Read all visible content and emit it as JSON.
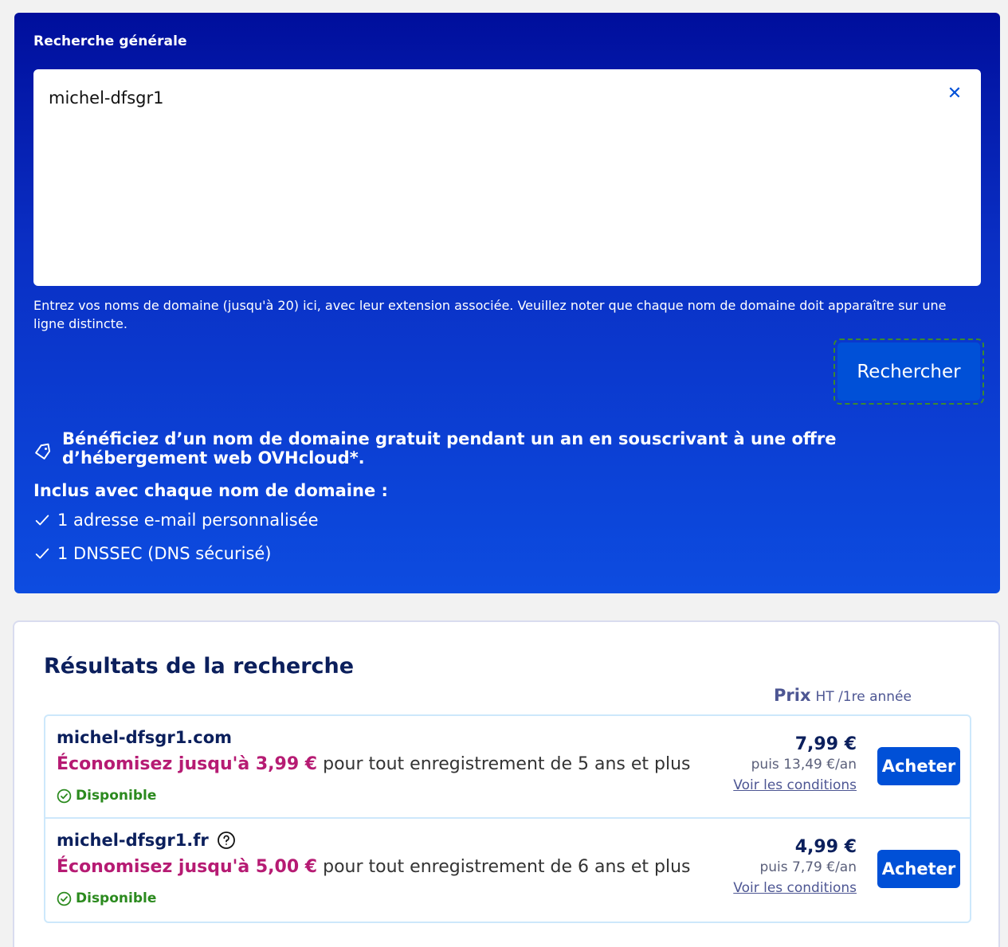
{
  "search": {
    "label": "Recherche générale",
    "value": "michel-dfsgr1",
    "clear_icon": "close-icon",
    "helper": "Entrez vos noms de domaine (jusqu'à 20) ici, avec leur extension associée. Veuillez noter que chaque nom de domaine doit apparaître sur une ligne distincte.",
    "button_label": "Rechercher"
  },
  "promo": {
    "icon": "tag-icon",
    "text": "Bénéficiez d’un nom de domaine gratuit pendant un an en souscrivant à une offre d’hébergement web OVHcloud*."
  },
  "included": {
    "title": "Inclus avec chaque nom de domaine :",
    "items": [
      {
        "icon": "check-icon",
        "label": "1 adresse e-mail personnalisée"
      },
      {
        "icon": "check-icon",
        "label": "1 DNSSEC (DNS sécurisé)"
      }
    ]
  },
  "results": {
    "title": "Résultats de la recherche",
    "price_header": {
      "label": "Prix",
      "sub": "HT /1re année"
    },
    "rows": [
      {
        "domain": "michel-dfsgr1.com",
        "saving": "Économisez jusqu'à 3,99 €",
        "saving_rest": " pour tout enregistrement de 5 ans et plus",
        "status": "Disponible",
        "price": "7,99 €",
        "then": "puis 13,49 €/an",
        "conditions": "Voir les conditions",
        "buy": "Acheter"
      },
      {
        "domain": "michel-dfsgr1.fr",
        "help_icon": "question-circle-icon",
        "saving": "Économisez jusqu'à 5,00 €",
        "saving_rest": " pour tout enregistrement de 6 ans et plus",
        "status": "Disponible",
        "price": "4,99 €",
        "then": "puis 7,79 €/an",
        "conditions": "Voir les conditions",
        "buy": "Acheter"
      }
    ]
  },
  "colors": {
    "panel_top": "#000e9c",
    "panel_bottom": "#0d4ce0",
    "accent_button": "#0050d7",
    "saving": "#b61b73",
    "available": "#2b8a1e",
    "heading": "#0b1f5c"
  }
}
